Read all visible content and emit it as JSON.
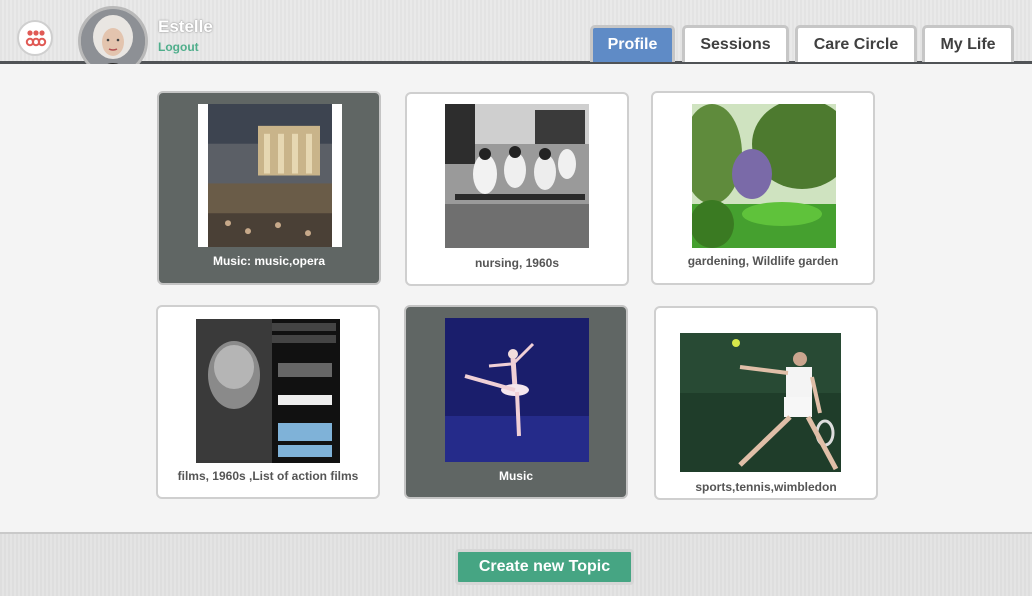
{
  "header": {
    "logo_icon": "people-group-icon",
    "user": {
      "name": "Estelle",
      "logout_label": "Logout",
      "avatar_icon": "user-avatar"
    },
    "tabs": [
      {
        "label": "Profile",
        "active": true
      },
      {
        "label": "Sessions",
        "active": false
      },
      {
        "label": "Care Circle",
        "active": false
      },
      {
        "label": "My Life",
        "active": false
      }
    ]
  },
  "topics": [
    {
      "caption": "Music: music,opera",
      "selected": true,
      "image": "opera-theatre-image"
    },
    {
      "caption": "nursing, 1960s",
      "selected": false,
      "image": "nursing-classroom-image"
    },
    {
      "caption": "gardening, Wildlife garden",
      "selected": false,
      "image": "wildlife-garden-image"
    },
    {
      "caption": "films, 1960s ,List of action films",
      "selected": false,
      "image": "paul-newman-book-image"
    },
    {
      "caption": "Music",
      "selected": true,
      "image": "ballet-dancer-image"
    },
    {
      "caption": "sports,tennis,wimbledon",
      "selected": false,
      "image": "tennis-player-image"
    }
  ],
  "footer": {
    "create_label": "Create new Topic"
  },
  "colors": {
    "accent_green": "#46a583",
    "active_tab_blue": "#5f8bc6",
    "selected_card": "#606664"
  }
}
